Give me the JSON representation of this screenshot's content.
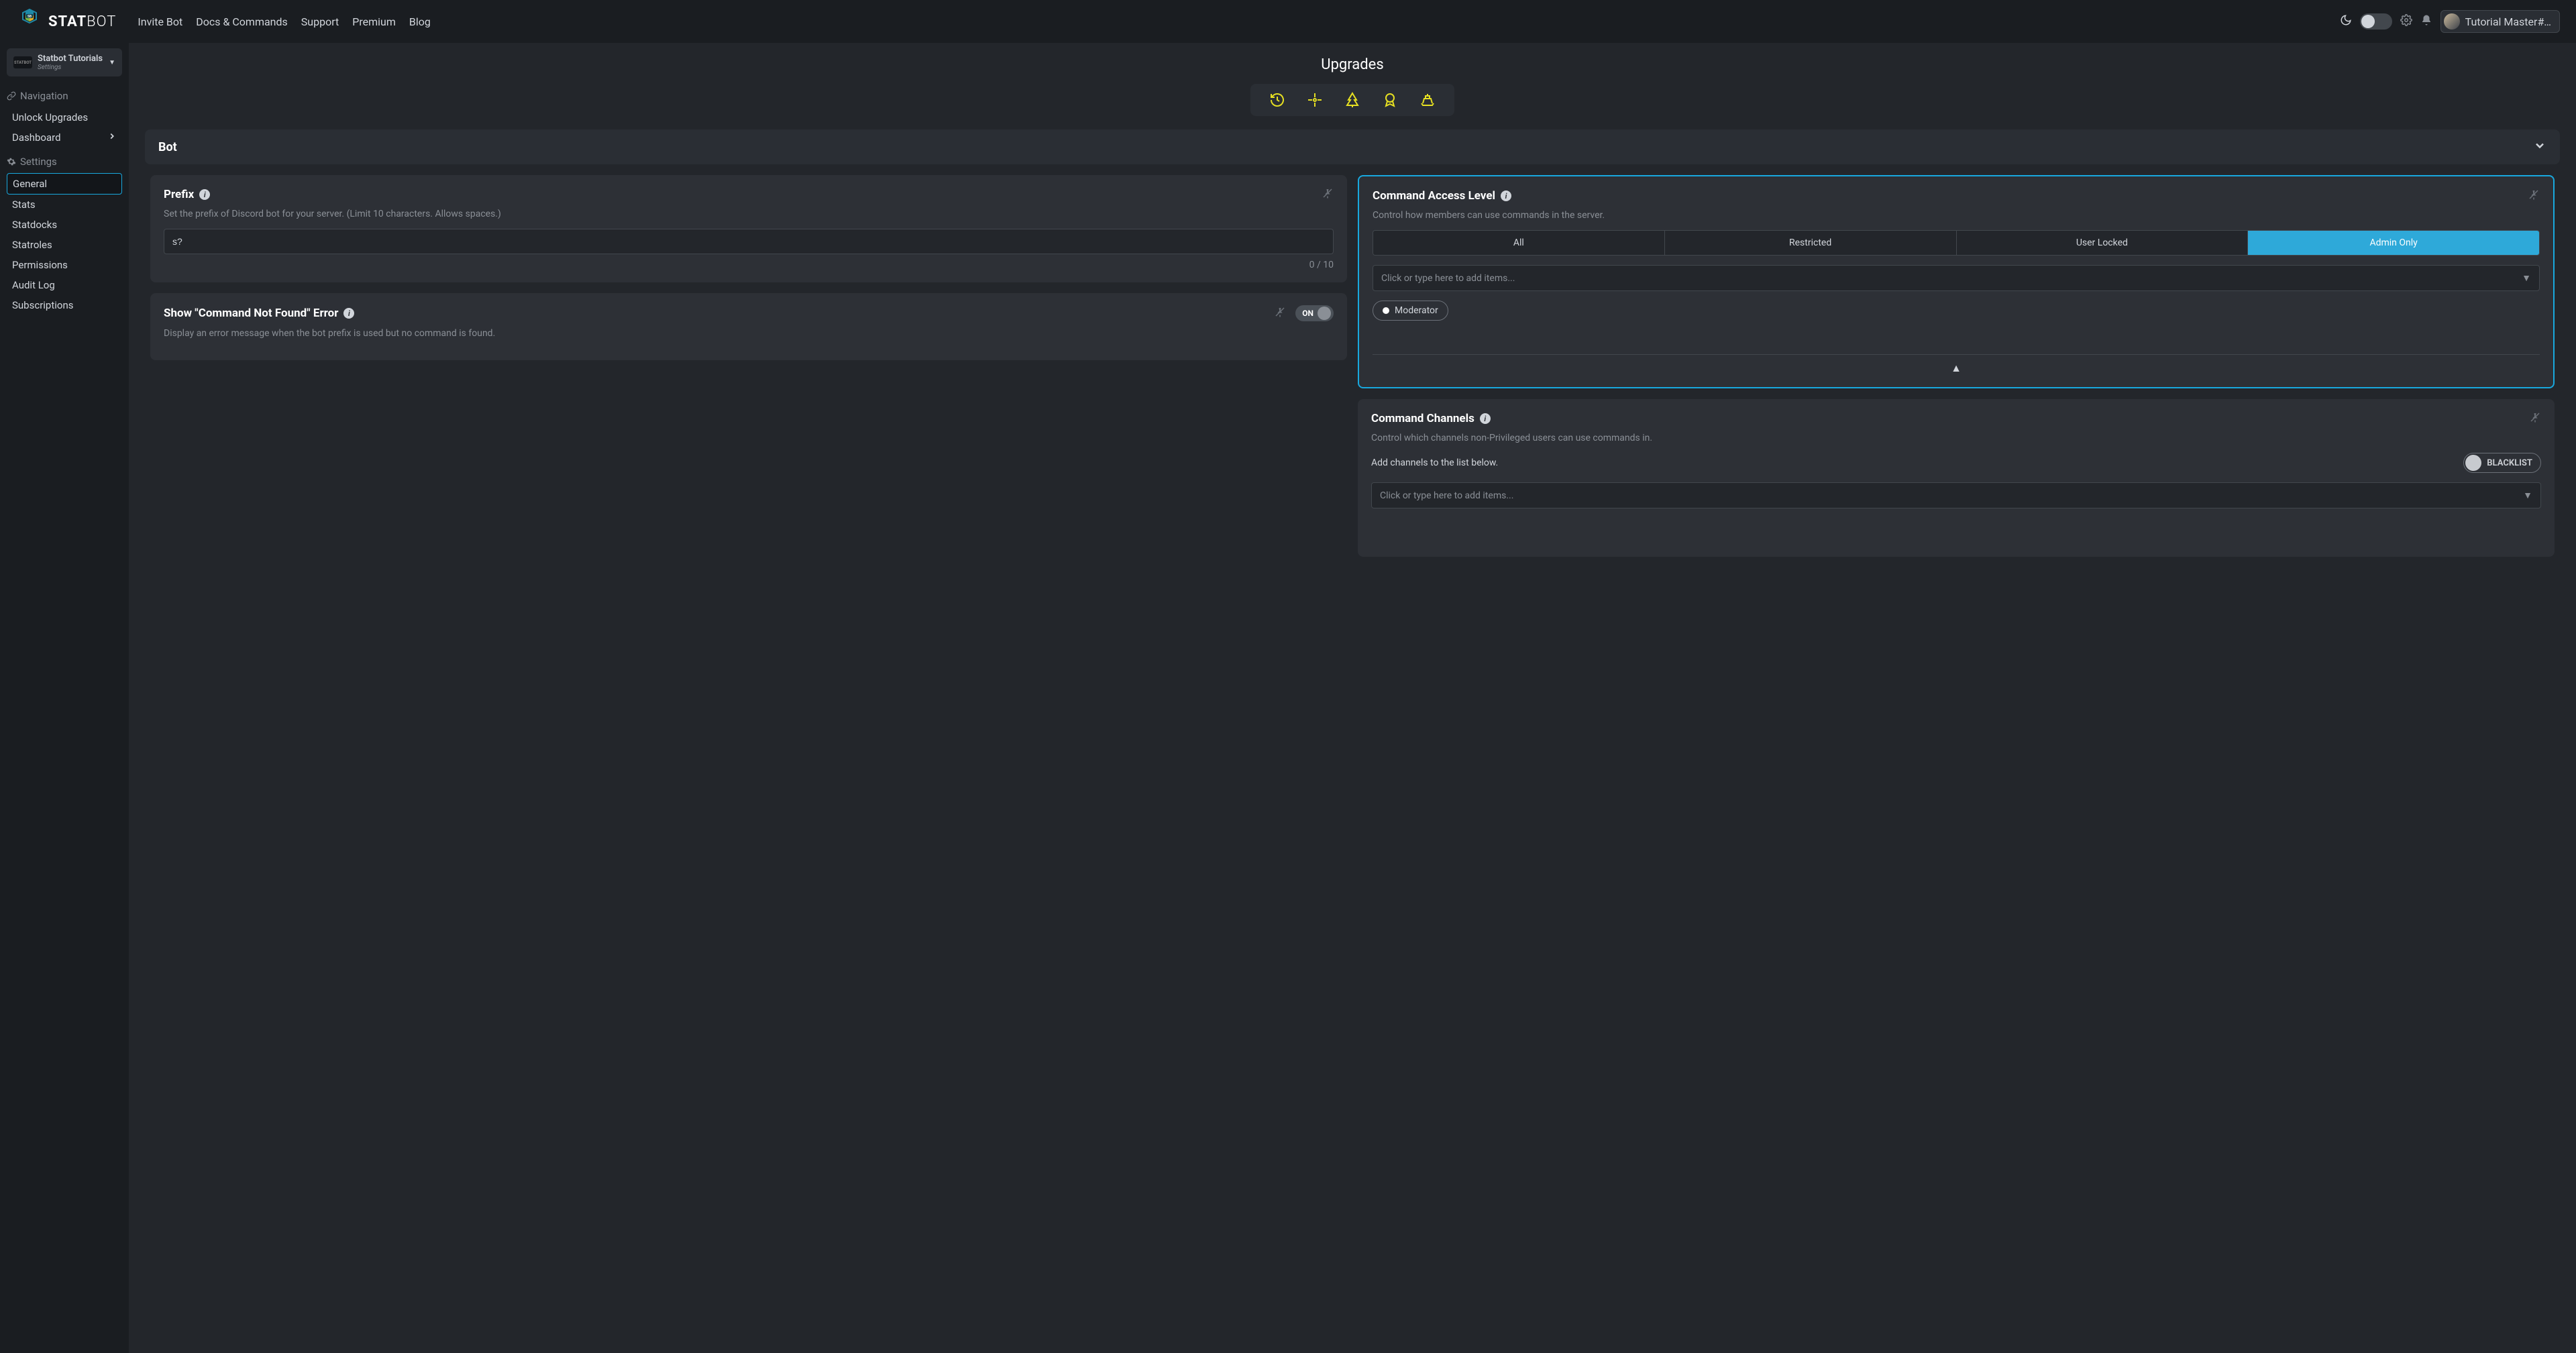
{
  "header": {
    "brand_first": "STAT",
    "brand_second": "BOT",
    "nav": [
      "Invite Bot",
      "Docs & Commands",
      "Support",
      "Premium",
      "Blog"
    ],
    "user": "Tutorial Master#…"
  },
  "sidebar": {
    "server_name": "Statbot Tutorials",
    "server_sub": "Settings",
    "nav_header": "Navigation",
    "nav_items": [
      "Unlock Upgrades",
      "Dashboard"
    ],
    "settings_header": "Settings",
    "settings_items": [
      "General",
      "Stats",
      "Statdocks",
      "Statroles",
      "Permissions",
      "Audit Log",
      "Subscriptions"
    ],
    "active_setting": "General"
  },
  "upgrades_title": "Upgrades",
  "bot_section": "Bot",
  "prefix": {
    "title": "Prefix",
    "desc": "Set the prefix of Discord bot for your server. (Limit 10 characters. Allows spaces.)",
    "value": "s?",
    "counter": "0 / 10"
  },
  "cnf": {
    "title": "Show \"Command Not Found\" Error",
    "desc": "Display an error message when the bot prefix is used but no command is found.",
    "toggle": "ON"
  },
  "cal": {
    "title": "Command Access Level",
    "desc": "Control how members can use commands in the server.",
    "options": [
      "All",
      "Restricted",
      "User Locked",
      "Admin Only"
    ],
    "active": "Admin Only",
    "dropdown_placeholder": "Click or type here to add items...",
    "tags": [
      "Moderator"
    ]
  },
  "cc": {
    "title": "Command Channels",
    "desc": "Control which channels non-Privileged users can use commands in.",
    "sub": "Add channels to the list below.",
    "blacklist": "BLACKLIST",
    "dropdown_placeholder": "Click or type here to add items..."
  }
}
